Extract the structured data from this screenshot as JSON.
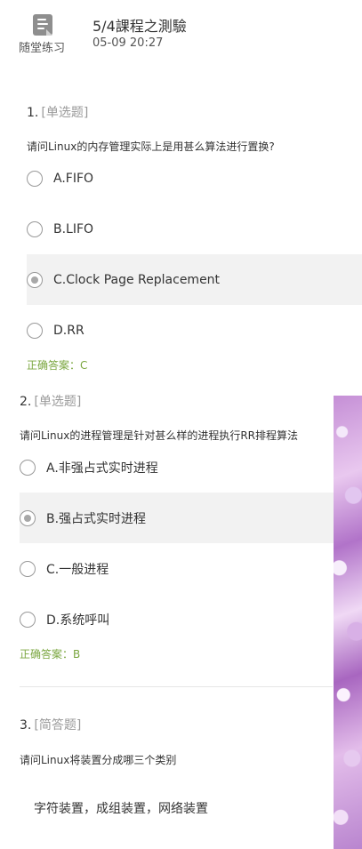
{
  "header": {
    "category_label": "随堂练习",
    "title": "5/4課程之測驗",
    "datetime": "05-09 20:27",
    "icon": "quiz-list-icon"
  },
  "questions": [
    {
      "number": "1.",
      "type": "[单选题]",
      "stem": "请问Linux的内存管理实际上是用甚么算法进行置换?",
      "options": [
        {
          "label": "A.FIFO",
          "selected": false
        },
        {
          "label": "B.LIFO",
          "selected": false
        },
        {
          "label": "C.Clock Page Replacement",
          "selected": true
        },
        {
          "label": "D.RR",
          "selected": false
        }
      ],
      "answer": "正确答案：C"
    },
    {
      "number": "2.",
      "type": "[单选题]",
      "stem": "请问Linux的进程管理是针对甚么样的进程执行RR排程算法",
      "options": [
        {
          "label": "A.非强占式实时进程",
          "selected": false
        },
        {
          "label": "B.强占式实时进程",
          "selected": true
        },
        {
          "label": "C.一般进程",
          "selected": false
        },
        {
          "label": "D.系统呼叫",
          "selected": false
        }
      ],
      "answer": "正确答案：B"
    },
    {
      "number": "3.",
      "type": "[简答题]",
      "stem": "请问Linux将装置分成哪三个类别",
      "response": "字符装置，成组装置，网络装置"
    }
  ],
  "colors": {
    "answer_green": "#7aa63f",
    "type_gray": "#9a9a9a",
    "selected_bg": "#f2f2f2",
    "radio_dot": "#a8a8a8"
  }
}
